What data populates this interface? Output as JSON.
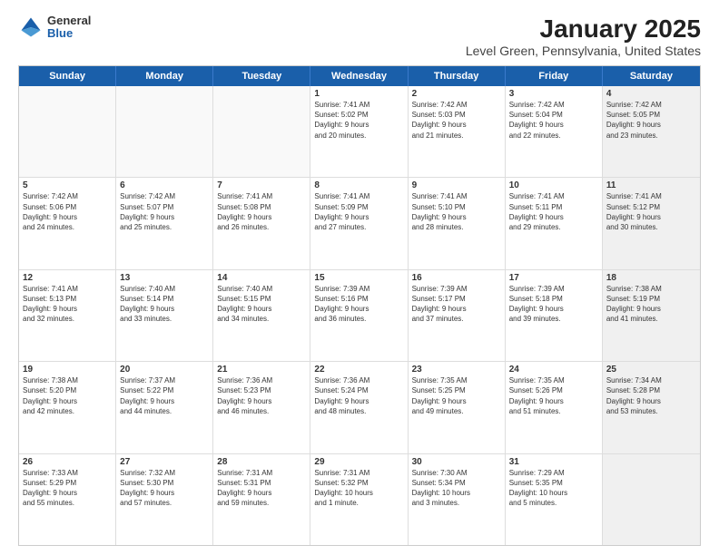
{
  "header": {
    "logo": {
      "line1": "General",
      "line2": "Blue"
    },
    "title": "January 2025",
    "subtitle": "Level Green, Pennsylvania, United States"
  },
  "weekdays": [
    "Sunday",
    "Monday",
    "Tuesday",
    "Wednesday",
    "Thursday",
    "Friday",
    "Saturday"
  ],
  "rows": [
    [
      {
        "day": "",
        "text": "",
        "empty": true
      },
      {
        "day": "",
        "text": "",
        "empty": true
      },
      {
        "day": "",
        "text": "",
        "empty": true
      },
      {
        "day": "1",
        "text": "Sunrise: 7:41 AM\nSunset: 5:02 PM\nDaylight: 9 hours\nand 20 minutes."
      },
      {
        "day": "2",
        "text": "Sunrise: 7:42 AM\nSunset: 5:03 PM\nDaylight: 9 hours\nand 21 minutes."
      },
      {
        "day": "3",
        "text": "Sunrise: 7:42 AM\nSunset: 5:04 PM\nDaylight: 9 hours\nand 22 minutes."
      },
      {
        "day": "4",
        "text": "Sunrise: 7:42 AM\nSunset: 5:05 PM\nDaylight: 9 hours\nand 23 minutes.",
        "shaded": true
      }
    ],
    [
      {
        "day": "5",
        "text": "Sunrise: 7:42 AM\nSunset: 5:06 PM\nDaylight: 9 hours\nand 24 minutes."
      },
      {
        "day": "6",
        "text": "Sunrise: 7:42 AM\nSunset: 5:07 PM\nDaylight: 9 hours\nand 25 minutes."
      },
      {
        "day": "7",
        "text": "Sunrise: 7:41 AM\nSunset: 5:08 PM\nDaylight: 9 hours\nand 26 minutes."
      },
      {
        "day": "8",
        "text": "Sunrise: 7:41 AM\nSunset: 5:09 PM\nDaylight: 9 hours\nand 27 minutes."
      },
      {
        "day": "9",
        "text": "Sunrise: 7:41 AM\nSunset: 5:10 PM\nDaylight: 9 hours\nand 28 minutes."
      },
      {
        "day": "10",
        "text": "Sunrise: 7:41 AM\nSunset: 5:11 PM\nDaylight: 9 hours\nand 29 minutes."
      },
      {
        "day": "11",
        "text": "Sunrise: 7:41 AM\nSunset: 5:12 PM\nDaylight: 9 hours\nand 30 minutes.",
        "shaded": true
      }
    ],
    [
      {
        "day": "12",
        "text": "Sunrise: 7:41 AM\nSunset: 5:13 PM\nDaylight: 9 hours\nand 32 minutes."
      },
      {
        "day": "13",
        "text": "Sunrise: 7:40 AM\nSunset: 5:14 PM\nDaylight: 9 hours\nand 33 minutes."
      },
      {
        "day": "14",
        "text": "Sunrise: 7:40 AM\nSunset: 5:15 PM\nDaylight: 9 hours\nand 34 minutes."
      },
      {
        "day": "15",
        "text": "Sunrise: 7:39 AM\nSunset: 5:16 PM\nDaylight: 9 hours\nand 36 minutes."
      },
      {
        "day": "16",
        "text": "Sunrise: 7:39 AM\nSunset: 5:17 PM\nDaylight: 9 hours\nand 37 minutes."
      },
      {
        "day": "17",
        "text": "Sunrise: 7:39 AM\nSunset: 5:18 PM\nDaylight: 9 hours\nand 39 minutes."
      },
      {
        "day": "18",
        "text": "Sunrise: 7:38 AM\nSunset: 5:19 PM\nDaylight: 9 hours\nand 41 minutes.",
        "shaded": true
      }
    ],
    [
      {
        "day": "19",
        "text": "Sunrise: 7:38 AM\nSunset: 5:20 PM\nDaylight: 9 hours\nand 42 minutes."
      },
      {
        "day": "20",
        "text": "Sunrise: 7:37 AM\nSunset: 5:22 PM\nDaylight: 9 hours\nand 44 minutes."
      },
      {
        "day": "21",
        "text": "Sunrise: 7:36 AM\nSunset: 5:23 PM\nDaylight: 9 hours\nand 46 minutes."
      },
      {
        "day": "22",
        "text": "Sunrise: 7:36 AM\nSunset: 5:24 PM\nDaylight: 9 hours\nand 48 minutes."
      },
      {
        "day": "23",
        "text": "Sunrise: 7:35 AM\nSunset: 5:25 PM\nDaylight: 9 hours\nand 49 minutes."
      },
      {
        "day": "24",
        "text": "Sunrise: 7:35 AM\nSunset: 5:26 PM\nDaylight: 9 hours\nand 51 minutes."
      },
      {
        "day": "25",
        "text": "Sunrise: 7:34 AM\nSunset: 5:28 PM\nDaylight: 9 hours\nand 53 minutes.",
        "shaded": true
      }
    ],
    [
      {
        "day": "26",
        "text": "Sunrise: 7:33 AM\nSunset: 5:29 PM\nDaylight: 9 hours\nand 55 minutes."
      },
      {
        "day": "27",
        "text": "Sunrise: 7:32 AM\nSunset: 5:30 PM\nDaylight: 9 hours\nand 57 minutes."
      },
      {
        "day": "28",
        "text": "Sunrise: 7:31 AM\nSunset: 5:31 PM\nDaylight: 9 hours\nand 59 minutes."
      },
      {
        "day": "29",
        "text": "Sunrise: 7:31 AM\nSunset: 5:32 PM\nDaylight: 10 hours\nand 1 minute."
      },
      {
        "day": "30",
        "text": "Sunrise: 7:30 AM\nSunset: 5:34 PM\nDaylight: 10 hours\nand 3 minutes."
      },
      {
        "day": "31",
        "text": "Sunrise: 7:29 AM\nSunset: 5:35 PM\nDaylight: 10 hours\nand 5 minutes."
      },
      {
        "day": "",
        "text": "",
        "empty": true,
        "shaded": true
      }
    ]
  ]
}
